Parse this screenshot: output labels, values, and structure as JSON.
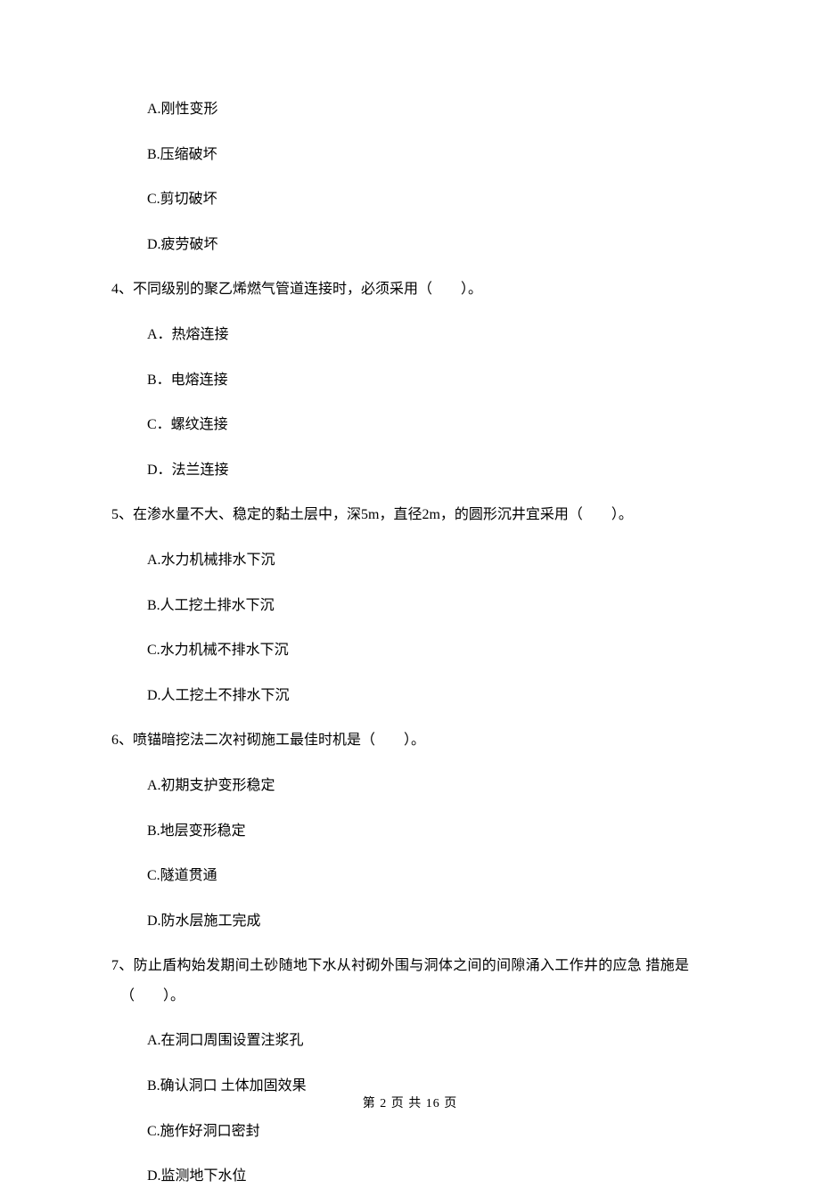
{
  "q3": {
    "options": {
      "a": "A.刚性变形",
      "b": "B.压缩破坏",
      "c": "C.剪切破坏",
      "d": "D.疲劳破坏"
    }
  },
  "q4": {
    "text": "4、不同级别的聚乙烯燃气管道连接时，必须采用（　　）。",
    "options": {
      "a": "A．热熔连接",
      "b": "B．电熔连接",
      "c": "C．螺纹连接",
      "d": "D．法兰连接"
    }
  },
  "q5": {
    "text": "5、在渗水量不大、稳定的黏土层中，深5m，直径2m，的圆形沉井宜采用（　　）。",
    "options": {
      "a": "A.水力机械排水下沉",
      "b": "B.人工挖土排水下沉",
      "c": "C.水力机械不排水下沉",
      "d": "D.人工挖土不排水下沉"
    }
  },
  "q6": {
    "text": "6、喷锚暗挖法二次衬砌施工最佳时机是（　　）。",
    "options": {
      "a": "A.初期支护变形稳定",
      "b": "B.地层变形稳定",
      "c": "C.隧道贯通",
      "d": "D.防水层施工完成"
    }
  },
  "q7": {
    "text_line1": "7、防止盾构始发期间土砂随地下水从衬砌外围与洞体之间的间隙涌入工作井的应急 措施是",
    "text_line2": "（　　）。",
    "options": {
      "a": "A.在洞口周围设置注浆孔",
      "b": "B.确认洞口 土体加固效果",
      "c": "C.施作好洞口密封",
      "d": "D.监测地下水位"
    }
  },
  "footer": "第 2 页 共 16 页"
}
